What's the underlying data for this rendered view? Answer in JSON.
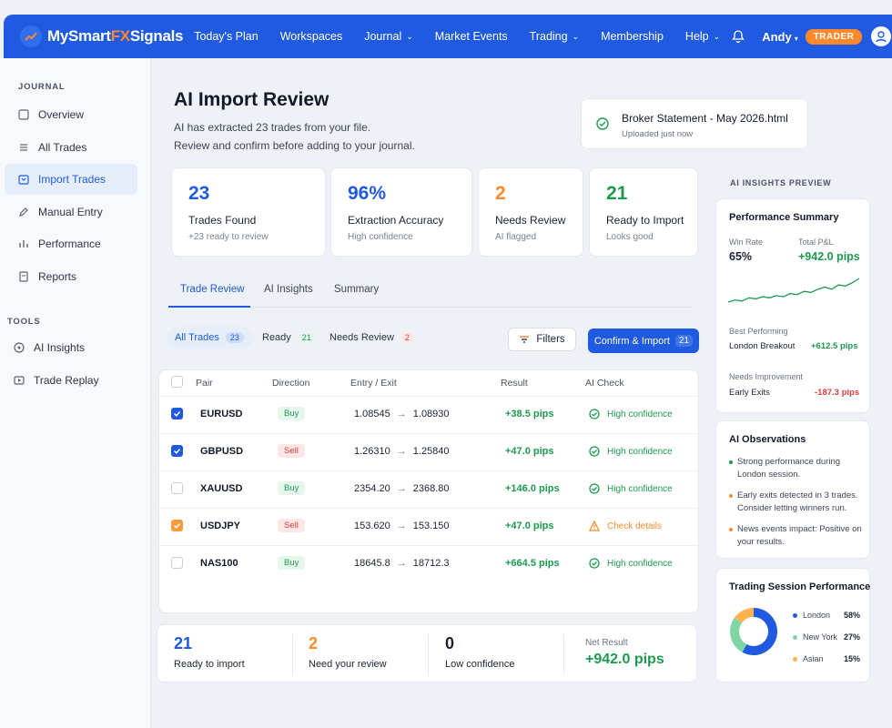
{
  "brand": {
    "name_a": "MySmart",
    "name_fx": "FX",
    "name_b": "Signals",
    "accent": "#1f5ae0",
    "orange": "#ff8a2b"
  },
  "nav": {
    "items": [
      {
        "label": "Today's Plan",
        "dropdown": false
      },
      {
        "label": "Workspaces",
        "dropdown": false
      },
      {
        "label": "Journal",
        "dropdown": true
      },
      {
        "label": "Market Events",
        "dropdown": false
      },
      {
        "label": "Trading",
        "dropdown": true
      },
      {
        "label": "Membership",
        "dropdown": false
      },
      {
        "label": "Help",
        "dropdown": true
      }
    ],
    "user": "Andy",
    "badge": "TRADER"
  },
  "sidebar": {
    "journal_head": "JOURNAL",
    "journal": [
      {
        "label": "Overview",
        "icon": "overview-icon"
      },
      {
        "label": "All Trades",
        "icon": "list-icon"
      },
      {
        "label": "Import Trades",
        "icon": "import-icon",
        "active": true
      },
      {
        "label": "Manual Entry",
        "icon": "edit-icon"
      },
      {
        "label": "Performance",
        "icon": "chart-icon"
      },
      {
        "label": "Reports",
        "icon": "report-icon"
      }
    ],
    "tools_head": "TOOLS",
    "tools": [
      {
        "label": "AI Insights",
        "icon": "ai-icon"
      },
      {
        "label": "Trade Replay",
        "icon": "replay-icon"
      }
    ]
  },
  "header": {
    "title": "AI Import Review",
    "sub1": "AI has extracted 23 trades from your file.",
    "sub2": "Review and confirm before adding to your journal."
  },
  "file": {
    "name": "Broker Statement - May 2026.html",
    "time": "Uploaded just now"
  },
  "stats": [
    {
      "num": "23",
      "label": "Trades Found",
      "sub": "+23 ready to review",
      "color": "#1f5ae0"
    },
    {
      "num": "96%",
      "label": "Extraction Accuracy",
      "sub": "High confidence",
      "color": "#1f5ae0"
    },
    {
      "num": "2",
      "label": "Needs Review",
      "sub": "AI flagged",
      "color": "#ff8a2b"
    },
    {
      "num": "21",
      "label": "Ready to Import",
      "sub": "Looks good",
      "color": "#1e9a4f"
    }
  ],
  "tabs": [
    "Trade Review",
    "AI Insights",
    "Summary"
  ],
  "pills": [
    {
      "label": "All Trades",
      "count": "23"
    },
    {
      "label": "Ready",
      "count": "21"
    },
    {
      "label": "Needs Review",
      "count": "2"
    }
  ],
  "filters_label": "Filters",
  "confirm": {
    "label": "Confirm & Import",
    "count": "21"
  },
  "table": {
    "headers": {
      "pair": "Pair",
      "direction": "Direction",
      "entry": "Entry / Exit",
      "result": "Result",
      "ai": "AI Check"
    },
    "rows": [
      {
        "check": "blue",
        "pair": "EURUSD",
        "dir": "Buy",
        "entry": "1.08545",
        "exit": "1.08930",
        "result": "+38.5 pips",
        "ai": "High confidence",
        "status": "ok"
      },
      {
        "check": "blue",
        "pair": "GBPUSD",
        "dir": "Sell",
        "entry": "1.26310",
        "exit": "1.25840",
        "result": "+47.0 pips",
        "ai": "High confidence",
        "status": "ok"
      },
      {
        "check": "none",
        "pair": "XAUUSD",
        "dir": "Buy",
        "entry": "2354.20",
        "exit": "2368.80",
        "result": "+146.0 pips",
        "ai": "High confidence",
        "status": "ok"
      },
      {
        "check": "orange",
        "pair": "USDJPY",
        "dir": "Sell",
        "entry": "153.620",
        "exit": "153.150",
        "result": "+47.0 pips",
        "ai": "Check details",
        "status": "warn"
      },
      {
        "check": "none",
        "pair": "NAS100",
        "dir": "Buy",
        "entry": "18645.8",
        "exit": "18712.3",
        "result": "+664.5 pips",
        "ai": "High confidence",
        "status": "ok"
      }
    ]
  },
  "summary": {
    "ready_num": "21",
    "ready_lbl": "Ready to import",
    "review_num": "2",
    "review_lbl": "Need your review",
    "low_num": "0",
    "low_lbl": "Low confidence",
    "net_lbl": "Net Result",
    "net_val": "+942.0 pips"
  },
  "insights": {
    "head": "AI INSIGHTS PREVIEW",
    "perf_title": "Performance Summary",
    "win_lbl": "Win Rate",
    "win_val": "65%",
    "pnl_lbl": "Total P&L",
    "pnl_val": "+942.0 pips",
    "best_lbl": "Best Performing",
    "best_name": "London Breakout",
    "best_val": "+612.5 pips",
    "worst_lbl": "Needs Improvement",
    "worst_name": "Early Exits",
    "worst_val": "-187.3 pips",
    "obs_title": "AI Observations",
    "observations": [
      {
        "text": "Strong performance during London session.",
        "color": "#1e9a4f"
      },
      {
        "text": "Early exits detected in 3 trades. Consider letting winners run.",
        "color": "#ff8a2b"
      },
      {
        "text": "News events impact: Positive on your results.",
        "color": "#ff8a2b"
      }
    ],
    "session_title": "Trading Session Performance",
    "sessions": [
      {
        "label": "London",
        "pct": "58%",
        "value": 58,
        "color": "#1f5ae0"
      },
      {
        "label": "New York",
        "pct": "27%",
        "value": 27,
        "color": "#7fd6a4"
      },
      {
        "label": "Asian",
        "pct": "15%",
        "value": 15,
        "color": "#ffb24d"
      }
    ],
    "spark": [
      10,
      11,
      10.5,
      12,
      11.5,
      12.5,
      12,
      13,
      12.5,
      14,
      13.5,
      15,
      14.5,
      16,
      17,
      16,
      18,
      17.5,
      19,
      21
    ]
  }
}
